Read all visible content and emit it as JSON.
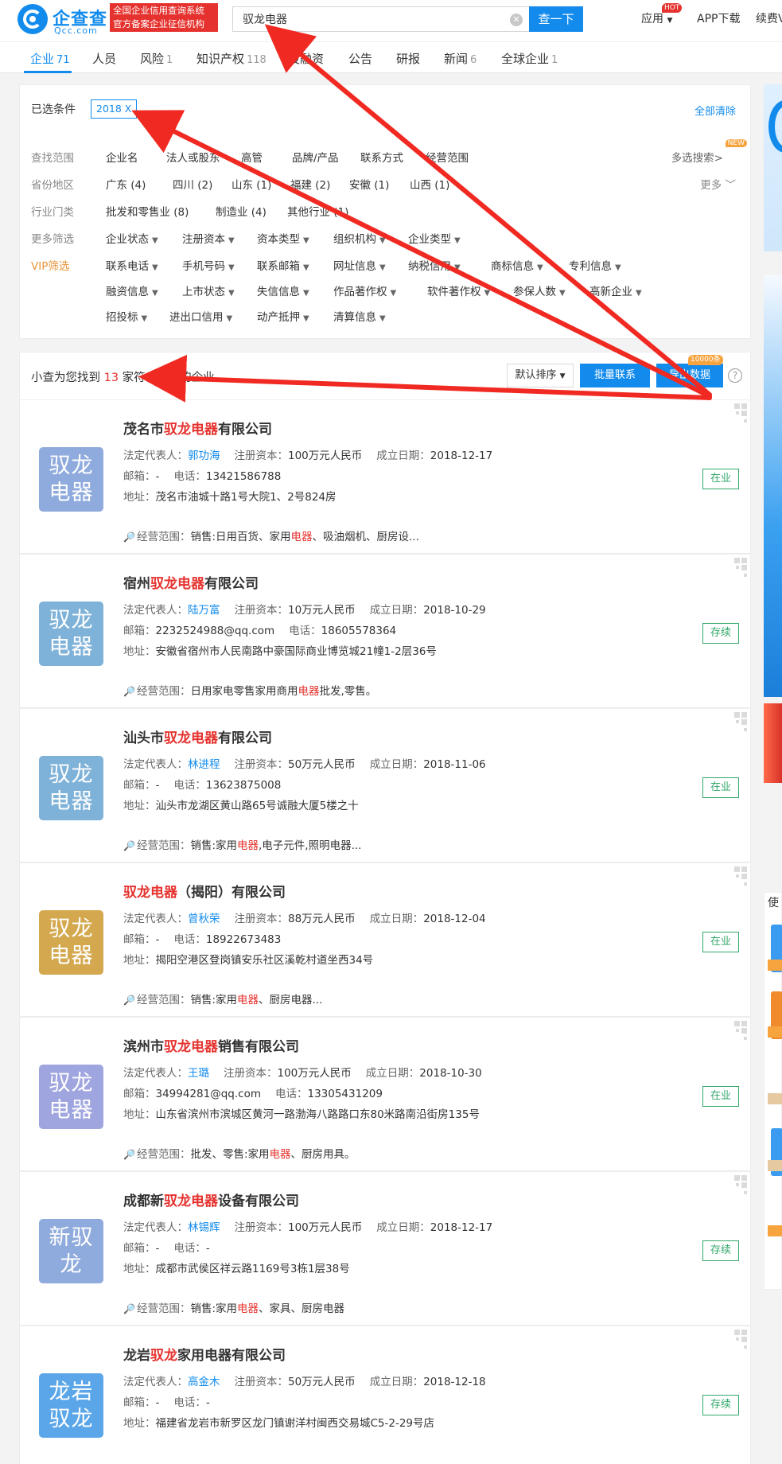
{
  "header": {
    "logo_cn": "企查查",
    "logo_en": "Qcc.com",
    "logo_tag_line1": "全国企业信用查询系统",
    "logo_tag_line2": "官方备案企业征信机构",
    "search_value": "驭龙电器",
    "search_button": "查一下",
    "nav_app": "应用",
    "hot_badge": "HOT",
    "nav_download": "APP下载",
    "nav_more": "续费VI"
  },
  "tabs": [
    {
      "label": "企业",
      "count": "71"
    },
    {
      "label": "人员",
      "count": ""
    },
    {
      "label": "风险",
      "count": "1"
    },
    {
      "label": "知识产权",
      "count": "118"
    },
    {
      "label": "投融资",
      "count": ""
    },
    {
      "label": "公告",
      "count": ""
    },
    {
      "label": "研报",
      "count": ""
    },
    {
      "label": "新闻",
      "count": "6"
    },
    {
      "label": "全球企业",
      "count": "1"
    }
  ],
  "filters": {
    "selected_label": "已选条件",
    "selected_tag": "2018 X",
    "clear_all": "全部清除",
    "multi_search": "多选搜索>",
    "new_badge": "NEW",
    "more": "更多 ﹀",
    "rows": {
      "scope": {
        "label": "查找范围",
        "items": [
          "企业名",
          "法人或股东",
          "高管",
          "品牌/产品",
          "联系方式",
          "经营范围"
        ]
      },
      "province": {
        "label": "省份地区",
        "items": [
          "广东 (4)",
          "四川 (2)",
          "山东 (1)",
          "福建 (2)",
          "安徽 (1)",
          "山西 (1)"
        ]
      },
      "industry": {
        "label": "行业门类",
        "items": [
          "批发和零售业 (8)",
          "制造业 (4)",
          "其他行业 (1)"
        ]
      },
      "more_filter": {
        "label": "更多筛选",
        "items": [
          "企业状态",
          "注册资本",
          "资本类型",
          "组织机构",
          "企业类型"
        ]
      },
      "vip": {
        "label": "VIP筛选",
        "items": [
          "联系电话",
          "手机号码",
          "联系邮箱",
          "网址信息",
          "纳税信用",
          "商标信息",
          "专利信息"
        ]
      },
      "vip2": {
        "items": [
          "融资信息",
          "上市状态",
          "失信信息",
          "作品著作权",
          "软件著作权",
          "参保人数",
          "高新企业"
        ]
      },
      "vip3": {
        "items": [
          "招投标",
          "进出口信用",
          "动产抵押",
          "清算信息"
        ]
      }
    }
  },
  "result": {
    "prefix": "小查为您找到",
    "count": "13",
    "suffix": "家符合条件的企业",
    "sort_button": "默认排序",
    "contact_button": "批量联系",
    "export_button": "导出数据",
    "export_badge": "10000条",
    "help": "?"
  },
  "labels": {
    "legal_rep": "法定代表人：",
    "reg_capital": "注册资本：",
    "est_date": "成立日期：",
    "email": "邮箱：",
    "phone": "电话：",
    "address": "地址：",
    "scope": "经营范围："
  },
  "companies": [
    {
      "name_pre": "茂名市",
      "name_hl": "驭龙电器",
      "name_post": "有限公司",
      "logo_line1": "驭龙",
      "logo_line2": "电器",
      "logo_color": "#8faadc",
      "legal_rep": "郭功海",
      "reg_capital": "100万元人民币",
      "est_date": "2018-12-17",
      "email": "-",
      "phone": "13421586788",
      "address": "茂名市油城十路1号大院1、2号824房",
      "scope_pre": "销售:日用百货、家用",
      "scope_hl": "电器",
      "scope_post": "、吸油烟机、厨房设...",
      "status": "在业"
    },
    {
      "name_pre": "宿州",
      "name_hl": "驭龙电器",
      "name_post": "有限公司",
      "logo_line1": "驭龙",
      "logo_line2": "电器",
      "logo_color": "#7fb2d8",
      "legal_rep": "陆万富",
      "reg_capital": "10万元人民币",
      "est_date": "2018-10-29",
      "email": "2232524988@qq.com",
      "phone": "18605578364",
      "address": "安徽省宿州市人民南路中豪国际商业博览城21幢1-2层36号",
      "scope_pre": "日用家电零售家用商用",
      "scope_hl": "电器",
      "scope_post": "批发,零售。",
      "status": "存续"
    },
    {
      "name_pre": "汕头市",
      "name_hl": "驭龙电器",
      "name_post": "有限公司",
      "logo_line1": "驭龙",
      "logo_line2": "电器",
      "logo_color": "#7fb2d8",
      "legal_rep": "林进程",
      "reg_capital": "50万元人民币",
      "est_date": "2018-11-06",
      "email": "-",
      "phone": "13623875008",
      "address": "汕头市龙湖区黄山路65号诚融大厦5楼之十",
      "scope_pre": "销售:家用",
      "scope_hl": "电器",
      "scope_post": ",电子元件,照明电器...",
      "status": "在业"
    },
    {
      "name_pre": "",
      "name_hl": "驭龙电器",
      "name_post": "（揭阳）有限公司",
      "logo_line1": "驭龙",
      "logo_line2": "电器",
      "logo_color": "#d4a84f",
      "legal_rep": "曾秋荣",
      "reg_capital": "88万元人民币",
      "est_date": "2018-12-04",
      "email": "-",
      "phone": "18922673483",
      "address": "揭阳空港区登岗镇安乐社区溪乾村道坐西34号",
      "scope_pre": "销售:家用",
      "scope_hl": "电器",
      "scope_post": "、厨房电器...",
      "status": "在业"
    },
    {
      "name_pre": "滨州市",
      "name_hl": "驭龙电器",
      "name_post": "销售有限公司",
      "logo_line1": "驭龙",
      "logo_line2": "电器",
      "logo_color": "#9fa5df",
      "legal_rep": "王璐",
      "reg_capital": "100万元人民币",
      "est_date": "2018-10-30",
      "email": "34994281@qq.com",
      "phone": "13305431209",
      "address": "山东省滨州市滨城区黄河一路渤海八路路口东80米路南沿街房135号",
      "scope_pre": "批发、零售:家用",
      "scope_hl": "电器",
      "scope_post": "、厨房用具。",
      "status": "在业"
    },
    {
      "name_pre": "成都新",
      "name_hl": "驭龙电器",
      "name_post": "设备有限公司",
      "logo_line1": "新驭",
      "logo_line2": "龙",
      "logo_color": "#8faadc",
      "legal_rep": "林锡辉",
      "reg_capital": "100万元人民币",
      "est_date": "2018-12-17",
      "email": "-",
      "phone": "-",
      "address": "成都市武侯区祥云路1169号3栋1层38号",
      "scope_pre": "销售:家用",
      "scope_hl": "电器",
      "scope_post": "、家具、厨房电器",
      "status": "存续"
    },
    {
      "name_pre": "龙岩",
      "name_hl": "驭龙",
      "name_post": "家用电器有限公司",
      "logo_line1": "龙岩",
      "logo_line2": "驭龙",
      "logo_color": "#5aa6e8",
      "legal_rep": "高金木",
      "reg_capital": "50万元人民币",
      "est_date": "2018-12-18",
      "email": "-",
      "phone": "-",
      "address": "福建省龙岩市新罗区龙门镇谢洋村闽西交易城C5-2-29号店",
      "scope_pre": "",
      "scope_hl": "",
      "scope_post": "",
      "status": "存续"
    }
  ],
  "side": {
    "label": "使"
  }
}
